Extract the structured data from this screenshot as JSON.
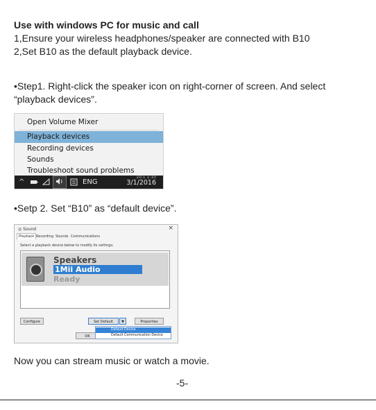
{
  "heading": "Use with windows PC for music and call",
  "intro_lines": [
    "1,Ensure your wireless headphones/speaker are connected with B10",
    "2,Set B10 as the default playback device."
  ],
  "step1_lines": [
    "•Step1. Right-click the speaker icon on right-corner of screen. And select",
    "“playback devices”."
  ],
  "context_menu": {
    "items": [
      "Open Volume Mixer",
      "Playback devices",
      "Recording devices",
      "Sounds",
      "Troubleshoot sound problems"
    ],
    "selected_index": 1,
    "taskbar": {
      "language": "ENG",
      "time": "10:1 1:10",
      "date": "3/1/2016"
    }
  },
  "step2_line": "•Setp 2. Set “B10” as “default device”.",
  "sound_dialog": {
    "title": "Sound",
    "close_glyph": "×",
    "tabs": [
      "Playback",
      "Recording",
      "Sounds",
      "Communications"
    ],
    "instruction": "Select a playback device below to modify its settings:",
    "device_name": "Speakers",
    "device_sub": "1Mii Audio",
    "device_status": "Ready",
    "configure_label": "Configure",
    "set_default_label": "Set Default",
    "properties_label": "Properties",
    "ok_label": "OK",
    "dropdown_options": [
      "Default Device",
      "Default Communication Device"
    ]
  },
  "closing_line": "Now you can stream music or watch a movie.",
  "page_number": "-5-"
}
